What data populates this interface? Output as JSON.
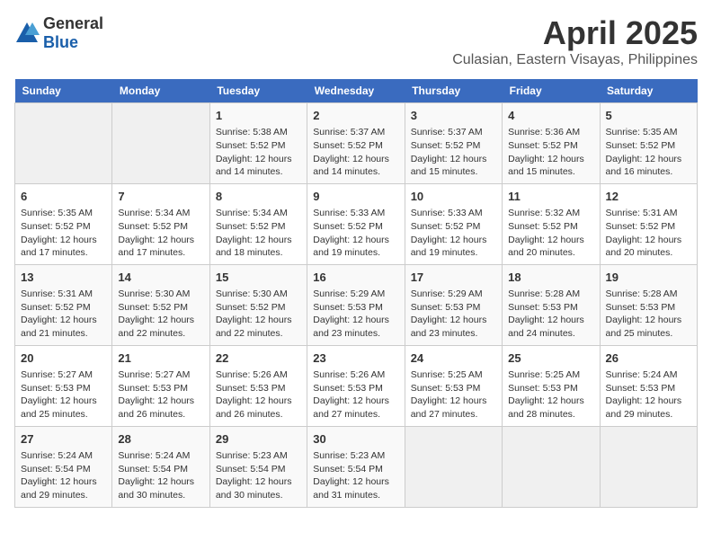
{
  "header": {
    "logo_general": "General",
    "logo_blue": "Blue",
    "title": "April 2025",
    "subtitle": "Culasian, Eastern Visayas, Philippines"
  },
  "days_of_week": [
    "Sunday",
    "Monday",
    "Tuesday",
    "Wednesday",
    "Thursday",
    "Friday",
    "Saturday"
  ],
  "weeks": [
    [
      {
        "day": "",
        "info": ""
      },
      {
        "day": "",
        "info": ""
      },
      {
        "day": "1",
        "info": "Sunrise: 5:38 AM\nSunset: 5:52 PM\nDaylight: 12 hours\nand 14 minutes."
      },
      {
        "day": "2",
        "info": "Sunrise: 5:37 AM\nSunset: 5:52 PM\nDaylight: 12 hours\nand 14 minutes."
      },
      {
        "day": "3",
        "info": "Sunrise: 5:37 AM\nSunset: 5:52 PM\nDaylight: 12 hours\nand 15 minutes."
      },
      {
        "day": "4",
        "info": "Sunrise: 5:36 AM\nSunset: 5:52 PM\nDaylight: 12 hours\nand 15 minutes."
      },
      {
        "day": "5",
        "info": "Sunrise: 5:35 AM\nSunset: 5:52 PM\nDaylight: 12 hours\nand 16 minutes."
      }
    ],
    [
      {
        "day": "6",
        "info": "Sunrise: 5:35 AM\nSunset: 5:52 PM\nDaylight: 12 hours\nand 17 minutes."
      },
      {
        "day": "7",
        "info": "Sunrise: 5:34 AM\nSunset: 5:52 PM\nDaylight: 12 hours\nand 17 minutes."
      },
      {
        "day": "8",
        "info": "Sunrise: 5:34 AM\nSunset: 5:52 PM\nDaylight: 12 hours\nand 18 minutes."
      },
      {
        "day": "9",
        "info": "Sunrise: 5:33 AM\nSunset: 5:52 PM\nDaylight: 12 hours\nand 19 minutes."
      },
      {
        "day": "10",
        "info": "Sunrise: 5:33 AM\nSunset: 5:52 PM\nDaylight: 12 hours\nand 19 minutes."
      },
      {
        "day": "11",
        "info": "Sunrise: 5:32 AM\nSunset: 5:52 PM\nDaylight: 12 hours\nand 20 minutes."
      },
      {
        "day": "12",
        "info": "Sunrise: 5:31 AM\nSunset: 5:52 PM\nDaylight: 12 hours\nand 20 minutes."
      }
    ],
    [
      {
        "day": "13",
        "info": "Sunrise: 5:31 AM\nSunset: 5:52 PM\nDaylight: 12 hours\nand 21 minutes."
      },
      {
        "day": "14",
        "info": "Sunrise: 5:30 AM\nSunset: 5:52 PM\nDaylight: 12 hours\nand 22 minutes."
      },
      {
        "day": "15",
        "info": "Sunrise: 5:30 AM\nSunset: 5:52 PM\nDaylight: 12 hours\nand 22 minutes."
      },
      {
        "day": "16",
        "info": "Sunrise: 5:29 AM\nSunset: 5:53 PM\nDaylight: 12 hours\nand 23 minutes."
      },
      {
        "day": "17",
        "info": "Sunrise: 5:29 AM\nSunset: 5:53 PM\nDaylight: 12 hours\nand 23 minutes."
      },
      {
        "day": "18",
        "info": "Sunrise: 5:28 AM\nSunset: 5:53 PM\nDaylight: 12 hours\nand 24 minutes."
      },
      {
        "day": "19",
        "info": "Sunrise: 5:28 AM\nSunset: 5:53 PM\nDaylight: 12 hours\nand 25 minutes."
      }
    ],
    [
      {
        "day": "20",
        "info": "Sunrise: 5:27 AM\nSunset: 5:53 PM\nDaylight: 12 hours\nand 25 minutes."
      },
      {
        "day": "21",
        "info": "Sunrise: 5:27 AM\nSunset: 5:53 PM\nDaylight: 12 hours\nand 26 minutes."
      },
      {
        "day": "22",
        "info": "Sunrise: 5:26 AM\nSunset: 5:53 PM\nDaylight: 12 hours\nand 26 minutes."
      },
      {
        "day": "23",
        "info": "Sunrise: 5:26 AM\nSunset: 5:53 PM\nDaylight: 12 hours\nand 27 minutes."
      },
      {
        "day": "24",
        "info": "Sunrise: 5:25 AM\nSunset: 5:53 PM\nDaylight: 12 hours\nand 27 minutes."
      },
      {
        "day": "25",
        "info": "Sunrise: 5:25 AM\nSunset: 5:53 PM\nDaylight: 12 hours\nand 28 minutes."
      },
      {
        "day": "26",
        "info": "Sunrise: 5:24 AM\nSunset: 5:53 PM\nDaylight: 12 hours\nand 29 minutes."
      }
    ],
    [
      {
        "day": "27",
        "info": "Sunrise: 5:24 AM\nSunset: 5:54 PM\nDaylight: 12 hours\nand 29 minutes."
      },
      {
        "day": "28",
        "info": "Sunrise: 5:24 AM\nSunset: 5:54 PM\nDaylight: 12 hours\nand 30 minutes."
      },
      {
        "day": "29",
        "info": "Sunrise: 5:23 AM\nSunset: 5:54 PM\nDaylight: 12 hours\nand 30 minutes."
      },
      {
        "day": "30",
        "info": "Sunrise: 5:23 AM\nSunset: 5:54 PM\nDaylight: 12 hours\nand 31 minutes."
      },
      {
        "day": "",
        "info": ""
      },
      {
        "day": "",
        "info": ""
      },
      {
        "day": "",
        "info": ""
      }
    ]
  ]
}
